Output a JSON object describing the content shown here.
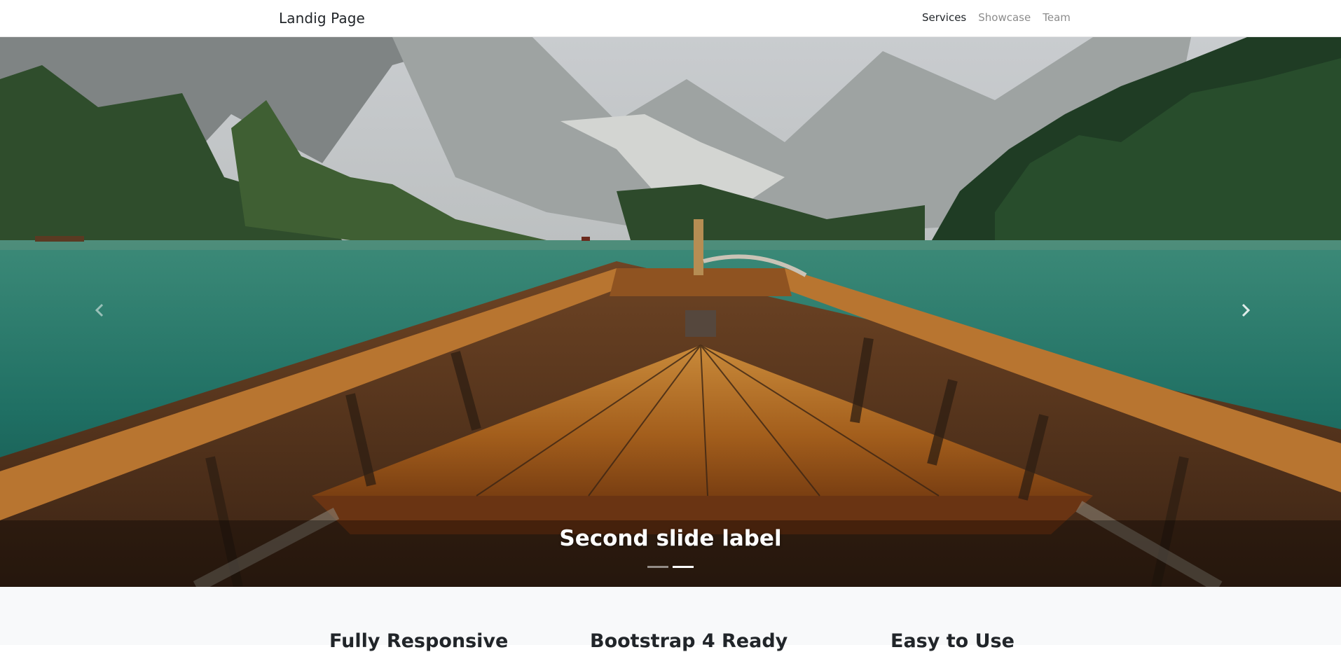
{
  "navbar": {
    "brand": "Landig Page",
    "items": [
      {
        "label": "Services",
        "active": true
      },
      {
        "label": "Showcase",
        "active": false
      },
      {
        "label": "Team",
        "active": false
      }
    ]
  },
  "carousel": {
    "caption": "Second slide label",
    "indicators": 2,
    "active_index": 1,
    "prev_icon": "chevron-left-icon",
    "next_icon": "chevron-right-icon"
  },
  "features": {
    "items": [
      {
        "title": "Fully Responsive"
      },
      {
        "title": "Bootstrap 4 Ready"
      },
      {
        "title": "Easy to Use"
      }
    ]
  },
  "colors": {
    "text": "#212529",
    "muted_nav": "#8c8c8c",
    "section_bg": "#f8f9fa"
  }
}
